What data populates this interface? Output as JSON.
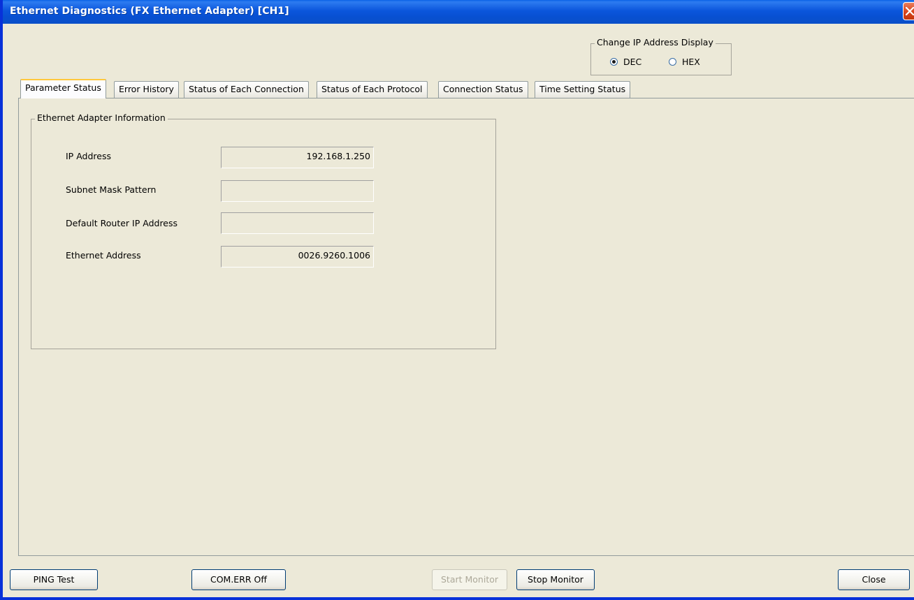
{
  "window": {
    "title": "Ethernet Diagnostics (FX Ethernet Adapter) [CH1]"
  },
  "ip_display": {
    "group_title": "Change IP Address Display",
    "options": [
      {
        "label": "DEC",
        "selected": true
      },
      {
        "label": "HEX",
        "selected": false
      }
    ]
  },
  "tabs": [
    {
      "label": "Parameter Status",
      "active": true
    },
    {
      "label": "Error History",
      "active": false
    },
    {
      "label": "Status of Each Connection",
      "active": false
    },
    {
      "label": "Status of Each Protocol",
      "active": false
    },
    {
      "label": "Connection Status",
      "active": false
    },
    {
      "label": "Time Setting Status",
      "active": false
    }
  ],
  "adapter_info": {
    "group_title": "Ethernet Adapter Information",
    "fields": [
      {
        "label": "IP Address",
        "value": "192.168.1.250"
      },
      {
        "label": "Subnet Mask Pattern",
        "value": ""
      },
      {
        "label": "Default Router IP Address",
        "value": ""
      },
      {
        "label": "Ethernet Address",
        "value": "0026.9260.1006"
      }
    ]
  },
  "buttons": {
    "ping_test": "PING Test",
    "com_err_off": "COM.ERR Off",
    "start_monitor": "Start Monitor",
    "stop_monitor": "Stop Monitor",
    "close": "Close"
  },
  "icons": {
    "close": "close-icon"
  }
}
